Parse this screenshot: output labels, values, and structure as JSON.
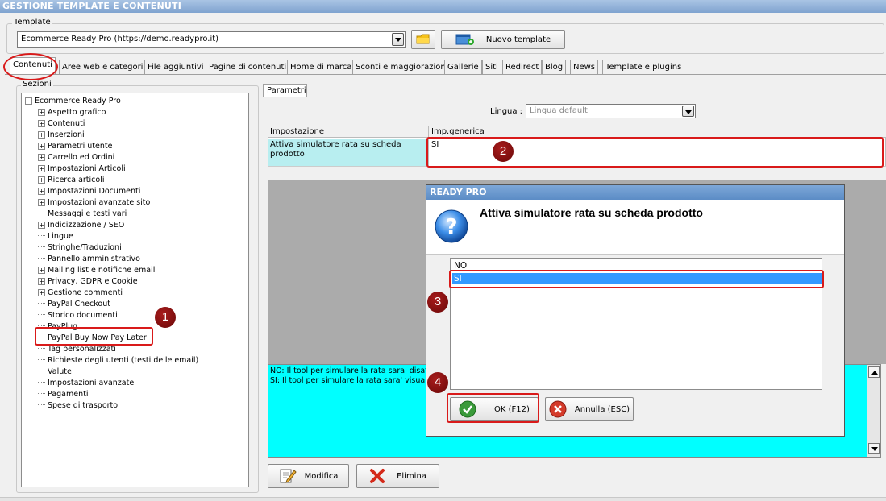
{
  "window": {
    "title": "GESTIONE TEMPLATE E CONTENUTI"
  },
  "template_group": {
    "legend": "Template",
    "selected_template": "Ecommerce Ready Pro (https://demo.readypro.it)",
    "new_template_label": "Nuovo template"
  },
  "tabs": [
    {
      "label": "Contenuti",
      "active": true
    },
    {
      "label": "Aree web e categorie"
    },
    {
      "label": "File aggiuntivi"
    },
    {
      "label": "Pagine di contenuti"
    },
    {
      "label": "Home di marca"
    },
    {
      "label": "Sconti e maggiorazioni"
    },
    {
      "label": "Gallerie"
    },
    {
      "label": "Siti"
    },
    {
      "label": "Redirect"
    },
    {
      "label": "Blog"
    },
    {
      "label": "News"
    },
    {
      "label": "Template e plugins"
    }
  ],
  "sections": {
    "legend": "Sezioni",
    "root": "Ecommerce Ready Pro",
    "items": [
      {
        "label": "Aspetto grafico",
        "expandable": true
      },
      {
        "label": "Contenuti",
        "expandable": true
      },
      {
        "label": "Inserzioni",
        "expandable": true
      },
      {
        "label": "Parametri utente",
        "expandable": true
      },
      {
        "label": "Carrello ed Ordini",
        "expandable": true
      },
      {
        "label": "Impostazioni Articoli",
        "expandable": true
      },
      {
        "label": "Ricerca articoli",
        "expandable": true
      },
      {
        "label": "Impostazioni Documenti",
        "expandable": true
      },
      {
        "label": "Impostazioni avanzate sito",
        "expandable": true
      },
      {
        "label": "Messaggi e testi vari",
        "expandable": false
      },
      {
        "label": "Indicizzazione / SEO",
        "expandable": true
      },
      {
        "label": "Lingue",
        "expandable": false
      },
      {
        "label": "Stringhe/Traduzioni",
        "expandable": false
      },
      {
        "label": "Pannello amministrativo",
        "expandable": false
      },
      {
        "label": "Mailing list e notifiche email",
        "expandable": true
      },
      {
        "label": "Privacy, GDPR e Cookie",
        "expandable": true
      },
      {
        "label": "Gestione commenti",
        "expandable": true
      },
      {
        "label": "PayPal Checkout",
        "expandable": false
      },
      {
        "label": "Storico documenti",
        "expandable": false
      },
      {
        "label": "PayPlug",
        "expandable": false
      },
      {
        "label": "PayPal Buy Now Pay Later",
        "expandable": false,
        "selected": true
      },
      {
        "label": "Tag personalizzati",
        "expandable": false
      },
      {
        "label": "Richieste degli utenti (testi delle email)",
        "expandable": false
      },
      {
        "label": "Valute",
        "expandable": false
      },
      {
        "label": "Impostazioni avanzate",
        "expandable": false
      },
      {
        "label": "Pagamenti",
        "expandable": false
      },
      {
        "label": "Spese di trasporto",
        "expandable": false
      }
    ]
  },
  "params": {
    "tab_label": "Parametri",
    "language_label": "Lingua :",
    "language_value": "Lingua default",
    "col_setting": "Impostazione",
    "col_value": "Imp.generica",
    "row_setting": "Attiva simulatore rata su scheda prodotto",
    "row_value": "SI",
    "help_line1": "NO: Il tool per simulare la rata sara' disattiva",
    "help_line2": "SI: Il tool per simulare la rata sara' visualiz",
    "edit_label": "Modifica",
    "delete_label": "Elimina"
  },
  "dialog": {
    "title": "READY PRO",
    "question": "Attiva simulatore rata su scheda prodotto",
    "options": [
      "NO",
      "SI"
    ],
    "selected_option": "SI",
    "ok_label": "OK (F12)",
    "cancel_label": "Annulla (ESC)"
  },
  "markers": [
    "1",
    "2",
    "3",
    "4"
  ],
  "colors": {
    "accent_red": "#d91a1a",
    "marker": "#8b0f0f",
    "selection": "#3399ff",
    "cyan_panel": "#00ffff",
    "row_highlight": "#b8eef0"
  }
}
